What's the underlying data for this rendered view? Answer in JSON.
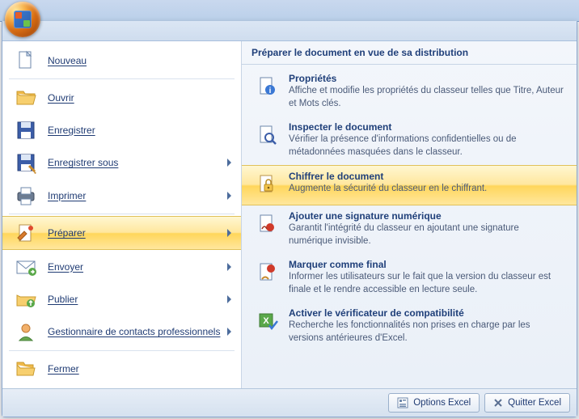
{
  "left_menu": [
    {
      "label": "Nouveau",
      "icon": "new-doc-icon",
      "arrow": false
    },
    {
      "label": "Ouvrir",
      "icon": "open-folder-icon",
      "arrow": false
    },
    {
      "label": "Enregistrer",
      "icon": "save-icon",
      "arrow": false
    },
    {
      "label": "Enregistrer sous",
      "icon": "save-as-icon",
      "arrow": true
    },
    {
      "label": "Imprimer",
      "icon": "print-icon",
      "arrow": true
    },
    {
      "label": "Préparer",
      "icon": "prepare-icon",
      "arrow": true,
      "selected": true
    },
    {
      "label": "Envoyer",
      "icon": "send-icon",
      "arrow": true
    },
    {
      "label": "Publier",
      "icon": "publish-icon",
      "arrow": true
    },
    {
      "label": "Gestionnaire de contacts professionnels",
      "icon": "contacts-icon",
      "arrow": true
    },
    {
      "label": "Fermer",
      "icon": "close-file-icon",
      "arrow": false
    }
  ],
  "separator_after": [
    0,
    4,
    8
  ],
  "right_header": "Préparer le document en vue de sa distribution",
  "right_items": [
    {
      "title": "Propriétés",
      "desc": "Affiche et modifie les propriétés du classeur telles que Titre, Auteur et Mots clés.",
      "icon": "properties-icon"
    },
    {
      "title": "Inspecter le document",
      "desc": "Vérifier la présence d'informations confidentielles ou de métadonnées masquées dans le classeur.",
      "icon": "inspect-icon"
    },
    {
      "title": "Chiffrer le document",
      "desc": "Augmente la sécurité du classeur en le chiffrant.",
      "icon": "encrypt-icon",
      "highlight": true
    },
    {
      "title": "Ajouter une signature numérique",
      "desc": "Garantit l'intégrité du classeur en ajoutant une signature numérique invisible.",
      "icon": "signature-icon"
    },
    {
      "title": "Marquer comme final",
      "desc": "Informer les utilisateurs sur le fait que la version du classeur est finale et le rendre accessible en lecture seule.",
      "icon": "mark-final-icon"
    },
    {
      "title": "Activer le vérificateur de compatibilité",
      "desc": "Recherche les fonctionnalités non prises en charge par les versions antérieures d'Excel.",
      "icon": "compat-check-icon"
    }
  ],
  "footer": {
    "options_label": "Options Excel",
    "quit_label": "Quitter Excel"
  }
}
